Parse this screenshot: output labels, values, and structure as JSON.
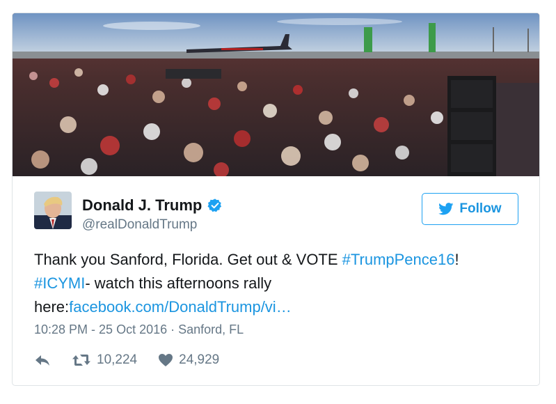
{
  "tweet": {
    "author_name": "Donald J. Trump",
    "handle": "@realDonaldTrump",
    "follow_label": "Follow",
    "text_part1": "Thank you Sanford, Florida. Get out & VOTE ",
    "hashtag1": "#TrumpPence16",
    "text_part2": "!",
    "hashtag2": "#ICYMI",
    "text_part3": "- watch this afternoons rally here:",
    "link": "facebook.com/DonaldTrump/vi…",
    "timestamp": "10:28 PM - 25 Oct 2016",
    "separator": " · ",
    "location": "Sanford, FL",
    "retweets": "10,224",
    "likes": "24,929"
  },
  "icons": {
    "verified": "verified-badge-icon",
    "follow": "bird-icon",
    "reply": "reply-icon",
    "retweet": "retweet-icon",
    "like": "heart-icon"
  },
  "colors": {
    "accent": "#1b95e0",
    "twitter_blue": "#1da1f2",
    "muted": "#657786",
    "text": "#14171a"
  }
}
